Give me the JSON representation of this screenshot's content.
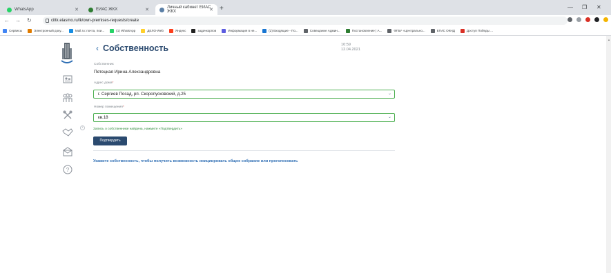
{
  "browser": {
    "tabs": [
      {
        "label": "WhatsApp",
        "icon": "whatsapp-icon",
        "color": "#25d366"
      },
      {
        "label": "ЕИАС ЖКХ",
        "icon": "eias-icon",
        "color": "#2e7d32"
      },
      {
        "label": "Личный кабинет ЕИАС ЖКХ",
        "icon": "eias-home-icon",
        "color": "#5b7fa6"
      }
    ],
    "url": "cittk.eiasmo.ru/lk/own-premises-requests/create",
    "bookmarks": [
      {
        "label": "Сервисы",
        "color": "#4285f4"
      },
      {
        "label": "Электронный доку...",
        "color": "#e07b00"
      },
      {
        "label": "Mail.ru: почта, пои...",
        "color": "#168de2"
      },
      {
        "label": "(1) WhatsApp",
        "color": "#25d366"
      },
      {
        "label": "ДЕЛО-Web",
        "color": "#ffd02b"
      },
      {
        "label": "Яндекс",
        "color": "#fc3f1d"
      },
      {
        "label": "задачкорпов",
        "color": "#222222"
      },
      {
        "label": "Информация в не...",
        "color": "#5c5ce0"
      },
      {
        "label": "(2) Входящие - По...",
        "color": "#1976d2"
      },
      {
        "label": "Совещание Админ...",
        "color": "#5f6368"
      },
      {
        "label": "Постановление | А...",
        "color": "#2e7d32"
      },
      {
        "label": "ФГБУ «Центрально...",
        "color": "#5f6368"
      },
      {
        "label": "ЕГИС ОКНД",
        "color": "#5f6368"
      },
      {
        "label": "Доступ Победы ...",
        "color": "#d93025"
      }
    ]
  },
  "page": {
    "title": "Собственность",
    "time": "10:59",
    "date": "12.04.2021",
    "owner_label": "Собственник",
    "owner_value": "Петецкая Ирина Александровна",
    "address_label": "Адрес дома",
    "address_value": "г. Сергиев Посад, рп. Скоропусковский, д.25",
    "room_label": "Номер помещения",
    "room_value": "кв.18",
    "required_mark": "*",
    "found_hint": "Запись о собственнике найдена, нажмите «Подтвердить»",
    "confirm_button": "Подтвердить",
    "info_text": "Укажите собственность, чтобы получить возможность инициировать общее собрание или проголосовать"
  },
  "sidebar": {
    "icons": [
      "profile-card-icon",
      "people-icon",
      "tools-icon",
      "handshake-icon",
      "mail-icon",
      "help-icon"
    ]
  },
  "colors": {
    "brand": "#2b4a6f",
    "accent_green": "#4caf50",
    "link_blue": "#2d6db3",
    "hint_green": "#2f8a3b"
  }
}
